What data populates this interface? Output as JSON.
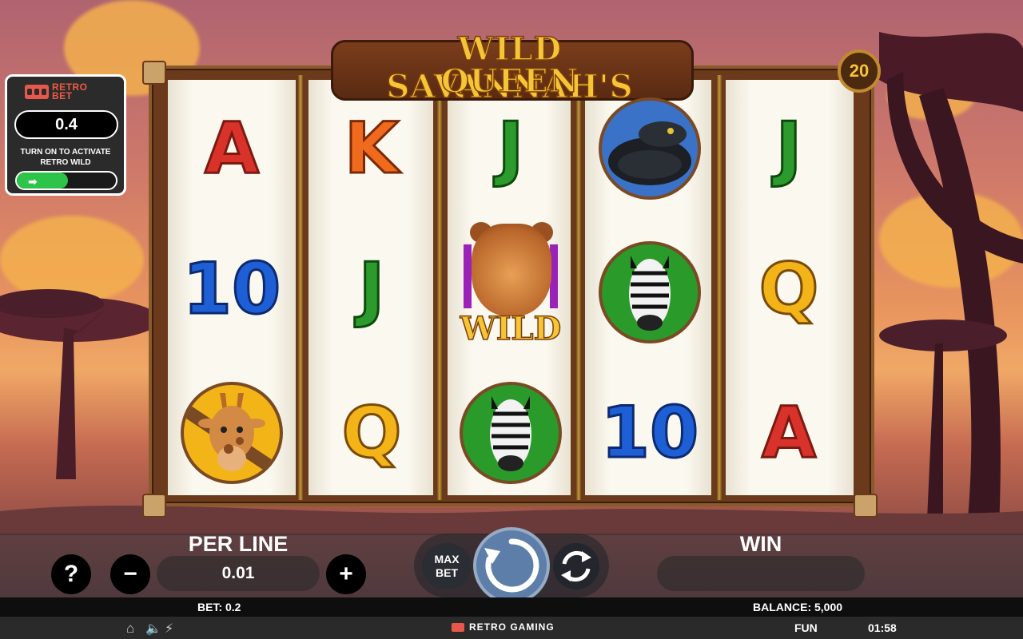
{
  "game": {
    "title_line1": "WILD SAVANNAH'S",
    "title_line2": "QUEEN",
    "paylines": "20"
  },
  "retro_bet": {
    "logo_line1": "RETRO",
    "logo_line2": "BET",
    "value": "0.4",
    "note_line1": "TURN ON TO ACTIVATE",
    "note_line2": "RETRO WILD",
    "toggle_icon": "arrow-right-icon",
    "toggle_state": "on"
  },
  "reels": [
    [
      "A",
      "10",
      "giraffe"
    ],
    [
      "K",
      "J",
      "Q"
    ],
    [
      "J",
      "lion-wild",
      "zebra"
    ],
    [
      "snake",
      "zebra",
      "10"
    ],
    [
      "J",
      "Q",
      "A"
    ]
  ],
  "wild_label": "WILD",
  "controls": {
    "help": "?",
    "per_line_label": "PER LINE",
    "per_line_value": "0.01",
    "minus": "−",
    "plus": "+",
    "max_bet_line1": "MAX",
    "max_bet_line2": "BET",
    "win_label": "WIN",
    "win_value": ""
  },
  "info": {
    "bet": "BET: 0.2",
    "balance": "BALANCE: 5,000",
    "mode": "FUN",
    "clock": "01:58",
    "brand": "RETRO GAMING"
  },
  "colors": {
    "ace": "#d9322b",
    "king": "#ef6a1d",
    "jack": "#2c9a2c",
    "ten": "#1e5fd6",
    "queen": "#f2b418",
    "toggle_on": "#2ec44a",
    "spin_button": "#5d7ea8"
  }
}
